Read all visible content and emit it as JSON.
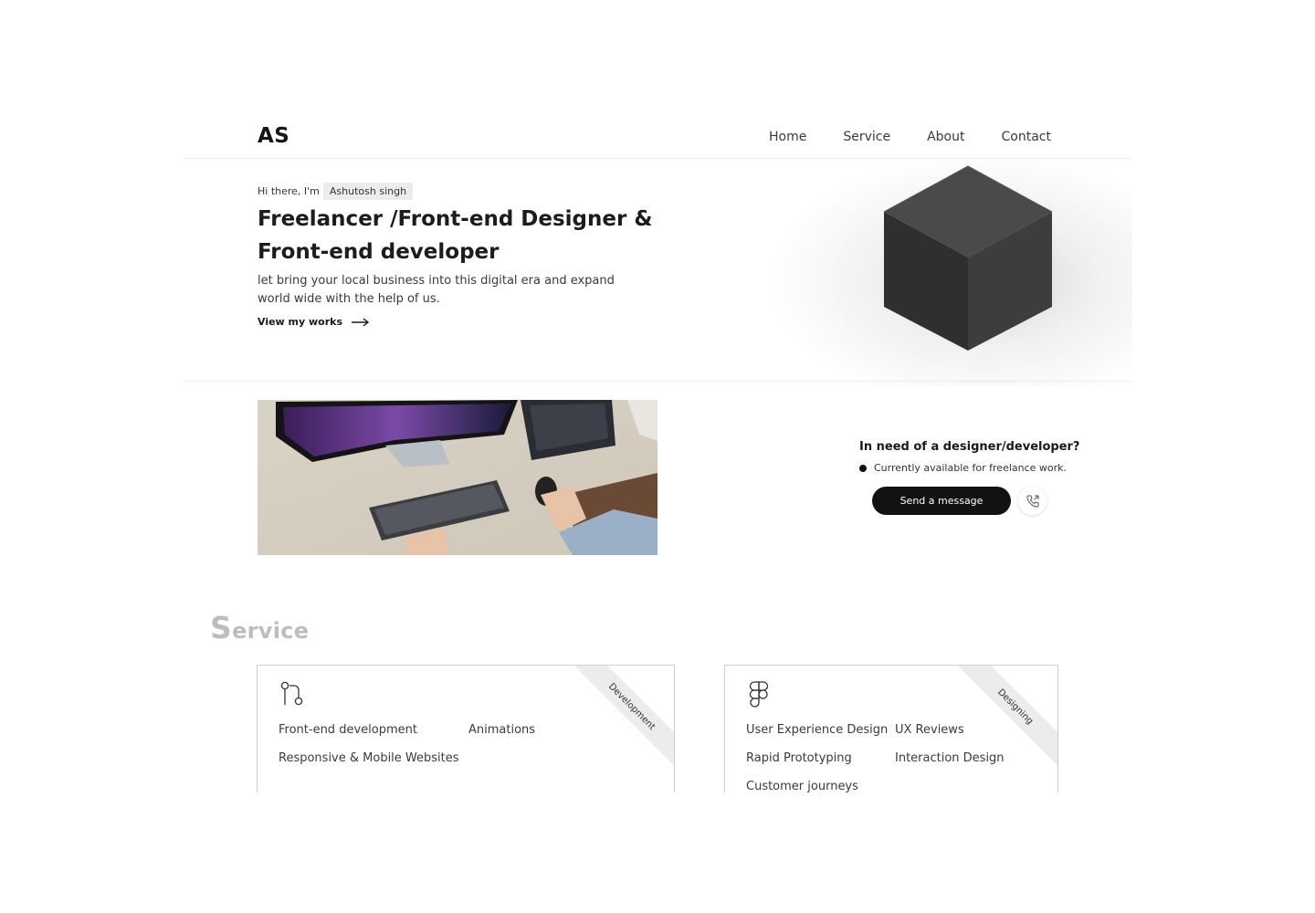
{
  "header": {
    "logo": "AS",
    "nav": [
      "Home",
      "Service",
      "About",
      "Contact"
    ]
  },
  "hero": {
    "greeting": "Hi there, I'm",
    "name": "Ashutosh singh",
    "headline": "Freelancer /Front-end Designer & Front-end developer",
    "lead": "let bring your local business into this digital era and expand world wide with the help of us.",
    "cta_link": "View my works"
  },
  "contact": {
    "title": "In need of a designer/developer?",
    "availability": "Currently available for freelance work.",
    "send_label": "Send a message"
  },
  "services": {
    "heading_cap": "S",
    "heading_rest": "ervice",
    "cards": [
      {
        "ribbon": "Development",
        "icon": "git-branch-icon",
        "items": [
          "Front-end development",
          "Animations",
          "Responsive & Mobile Websites"
        ]
      },
      {
        "ribbon": "Designing",
        "icon": "figma-icon",
        "items": [
          "User Experience Design",
          "UX Reviews",
          "Rapid Prototyping",
          "Interaction Design",
          "Customer journeys"
        ]
      }
    ]
  },
  "colors": {
    "text": "#1a1a1a",
    "button_dark": "#121212",
    "heading_muted": "#bdbdbd",
    "chip_bg": "#ececec"
  }
}
